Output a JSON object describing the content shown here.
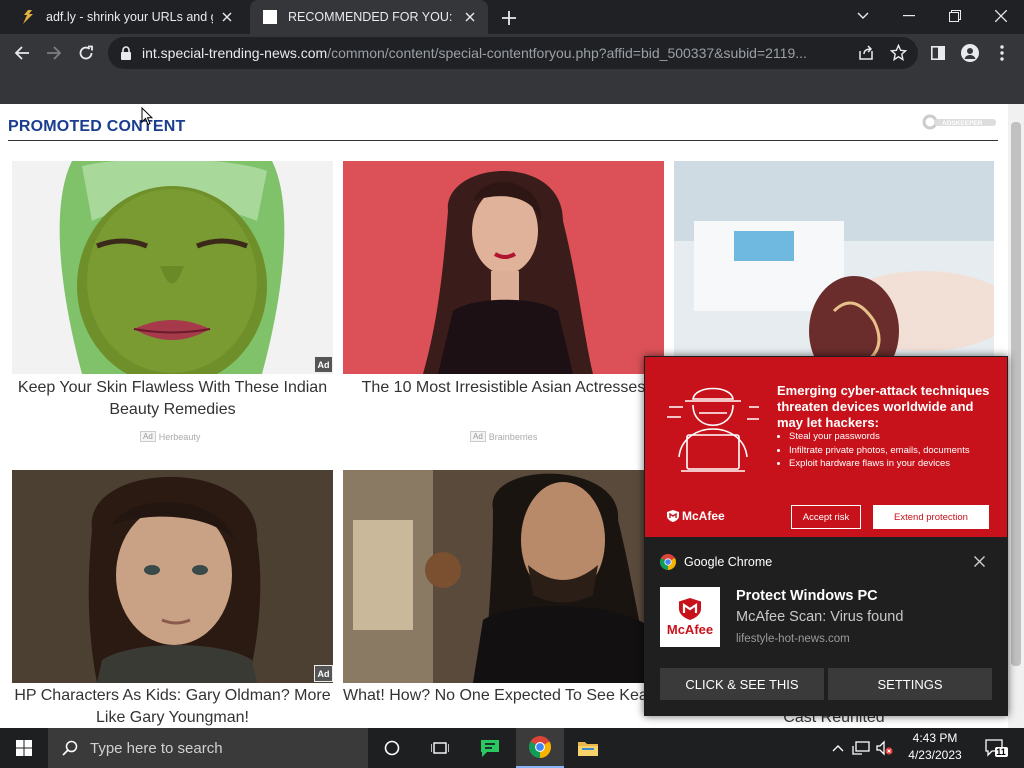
{
  "browser": {
    "tabs": [
      {
        "title": "adf.ly - shrink your URLs and get paid!",
        "active": false
      },
      {
        "title": "RECOMMENDED FOR YOU:",
        "active": true
      }
    ],
    "url_host": "int.special-trending-news.com",
    "url_path": "/common/content/special-contentforyou.php?affid=bid_500337&subid=2119..."
  },
  "page": {
    "promo_title": "PROMOTED CONTENT",
    "adskeeper_label": "ADSKEEPER",
    "ad_badge": "Ad",
    "cards": [
      {
        "title": "Keep Your Skin Flawless With These Indian Beauty Remedies",
        "source": "Herbeauty"
      },
      {
        "title": "The 10 Most Irresistible Asian Actresses",
        "source": "Brainberries"
      },
      {
        "title": "HP Characters As Kids: Gary Oldman? More Like Gary Youngman!",
        "source": ""
      },
      {
        "title": "What! How? No One Expected To See Keanu On This List",
        "source": ""
      },
      {
        "title": "Cast Reunited",
        "source": ""
      }
    ]
  },
  "popup": {
    "banner_heading": "Emerging cyber-attack techniques threaten devices worldwide and may let hackers:",
    "banner_items": [
      "Steal your passwords",
      "Infiltrate private photos, emails, documents",
      "Exploit hardware flaws in your devices"
    ],
    "banner_brand": "McAfee",
    "accept_risk": "Accept risk",
    "extend_protection": "Extend protection",
    "source_app": "Google Chrome",
    "icon_text": "McAfee",
    "heading": "Protect Windows PC",
    "body": "McAfee Scan: Virus found",
    "site": "lifestyle-hot-news.com",
    "btn_primary": "CLICK & SEE THIS",
    "btn_settings": "SETTINGS"
  },
  "taskbar": {
    "search_placeholder": "Type here to search",
    "time": "4:43 PM",
    "date": "4/23/2023",
    "notification_count": "11"
  },
  "colors": {
    "promo_title": "#1a3d8f",
    "banner_red": "#c8121b",
    "chrome_dark": "#202124"
  }
}
